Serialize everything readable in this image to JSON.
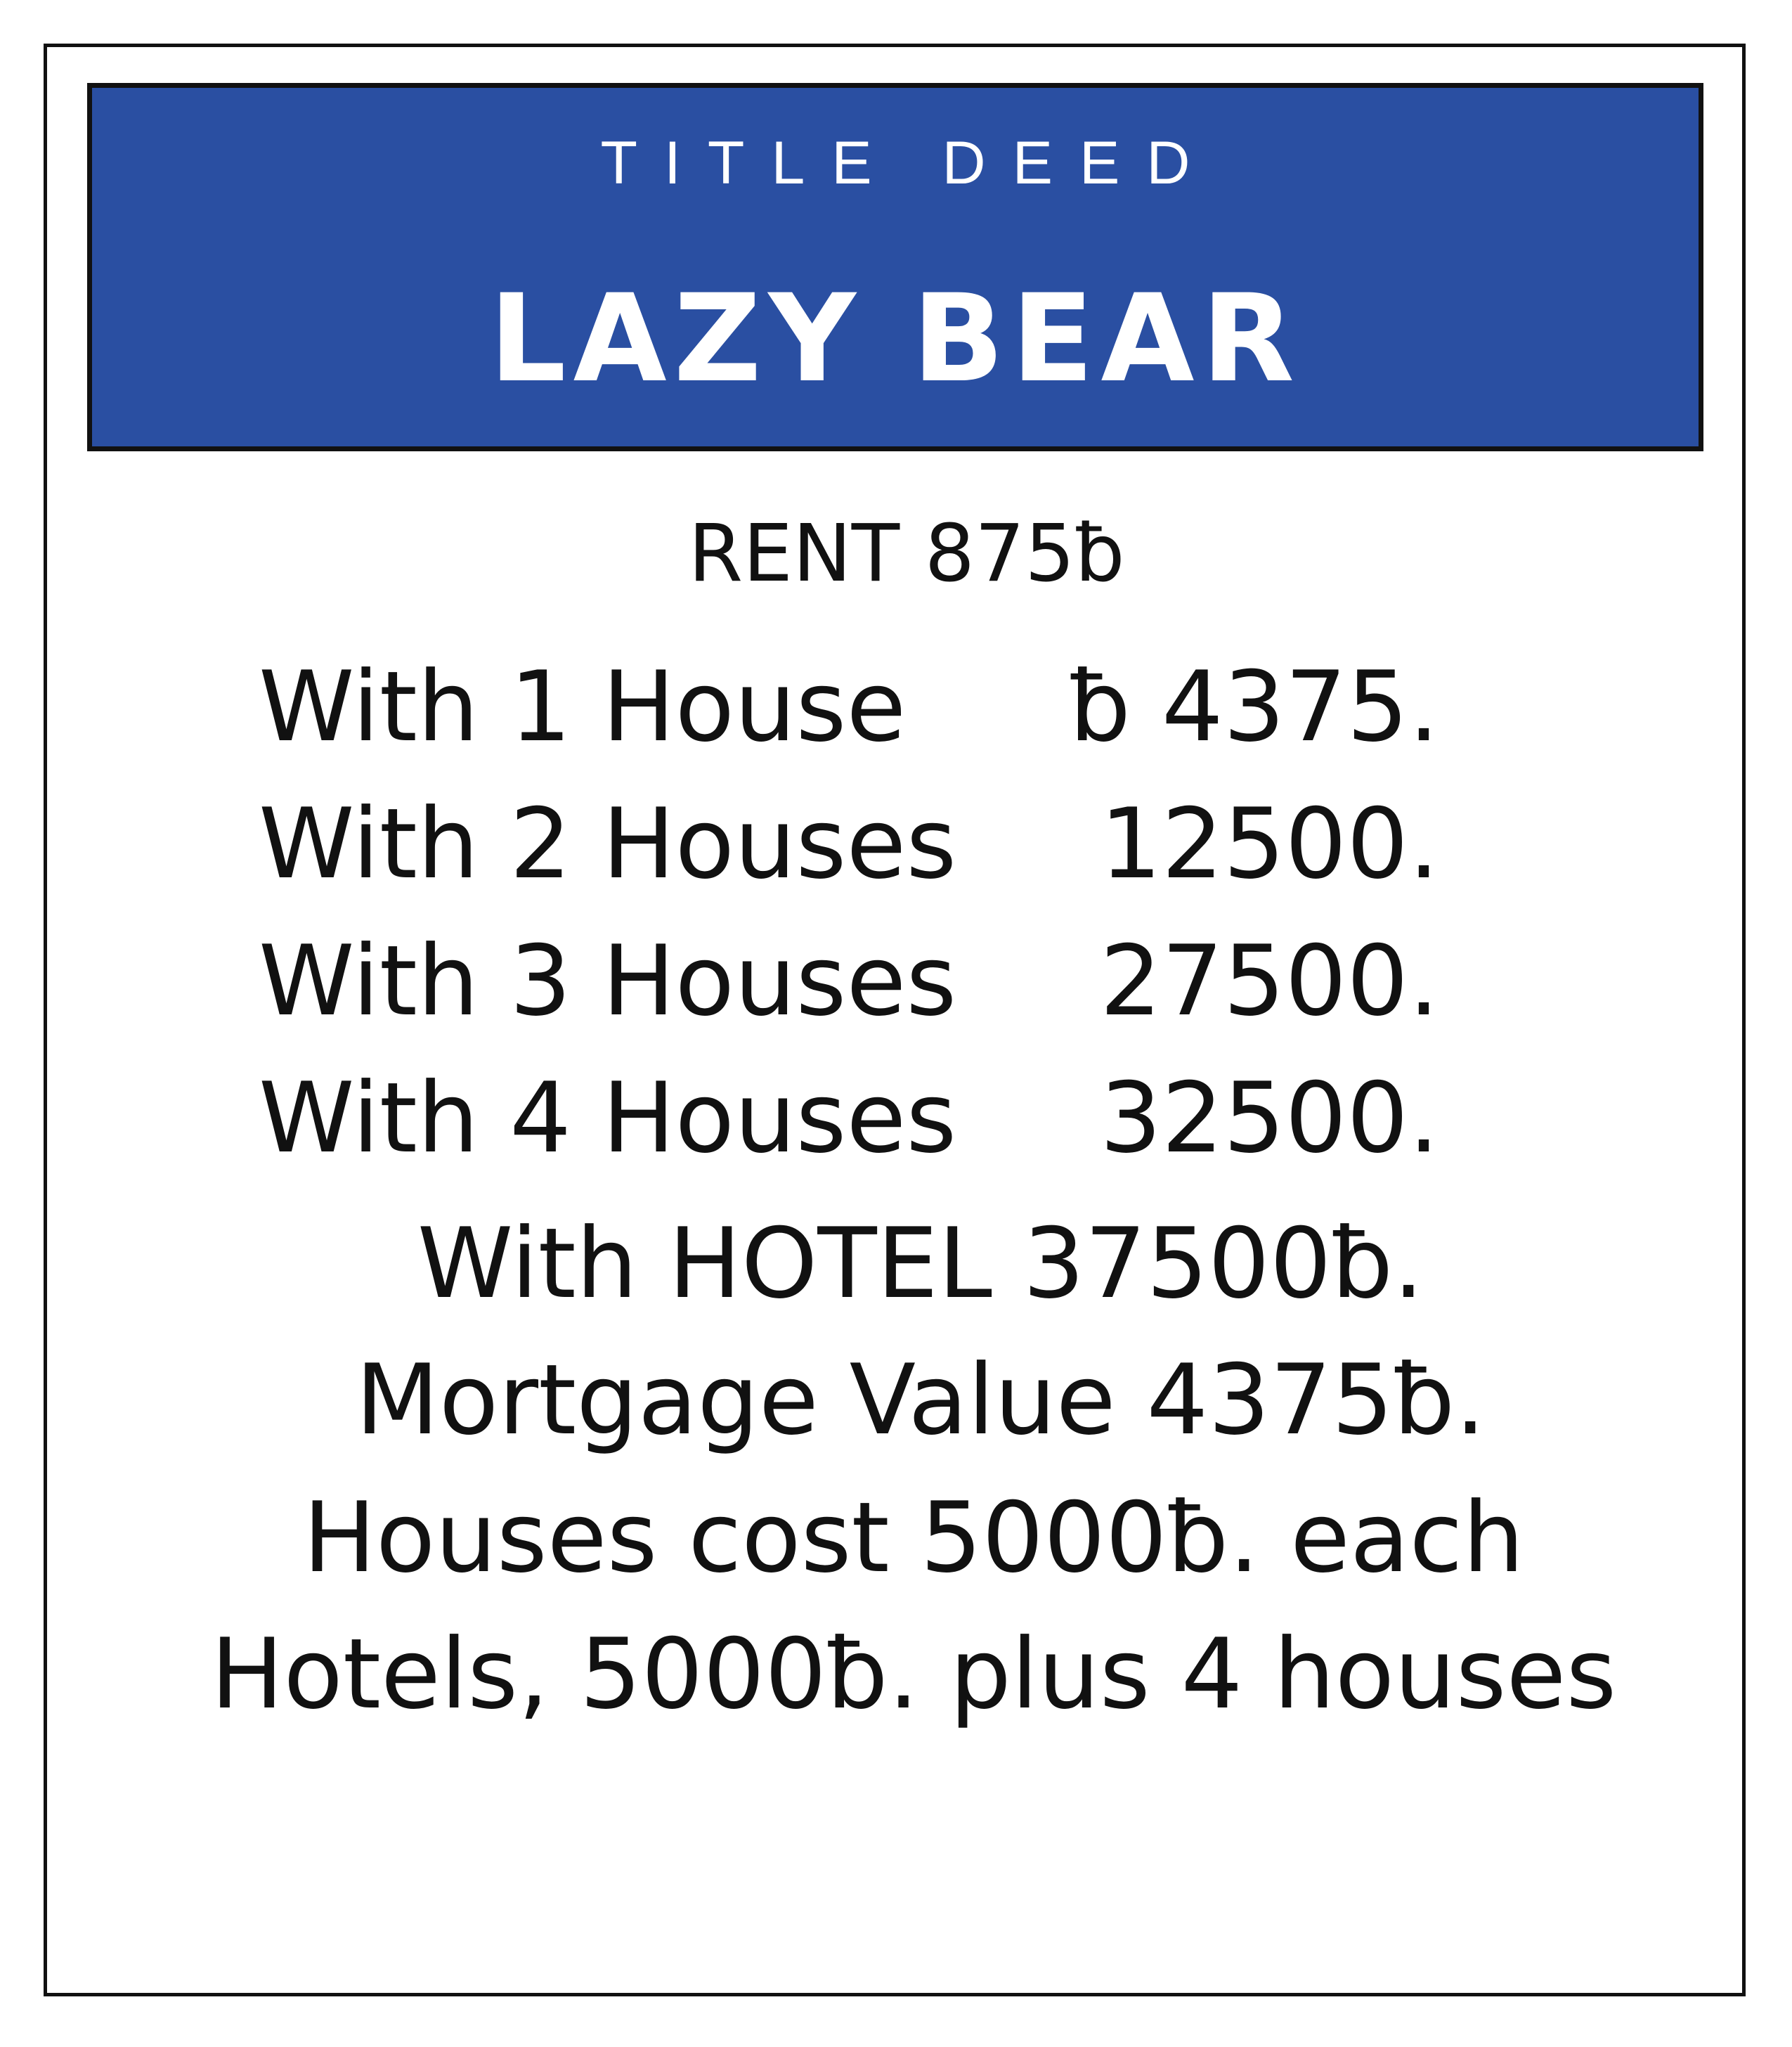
{
  "card": {
    "kicker": "TITLE DEED",
    "property_name": "LAZY BEAR",
    "header_color": "#2a4fa2",
    "rent": "RENT 875ƀ",
    "house_rents": [
      {
        "label": "With 1 House",
        "amount": "ƀ 4375."
      },
      {
        "label": "With 2 Houses",
        "amount": "12500."
      },
      {
        "label": "With 3 Houses",
        "amount": "27500."
      },
      {
        "label": "With 4 Houses",
        "amount": "32500."
      }
    ],
    "hotel_rent": "With HOTEL 37500ƀ.",
    "mortgage": "Mortgage Value 4375ƀ.",
    "house_cost": "Houses cost 5000ƀ. each",
    "hotel_cost": "Hotels, 5000ƀ. plus 4 houses"
  }
}
